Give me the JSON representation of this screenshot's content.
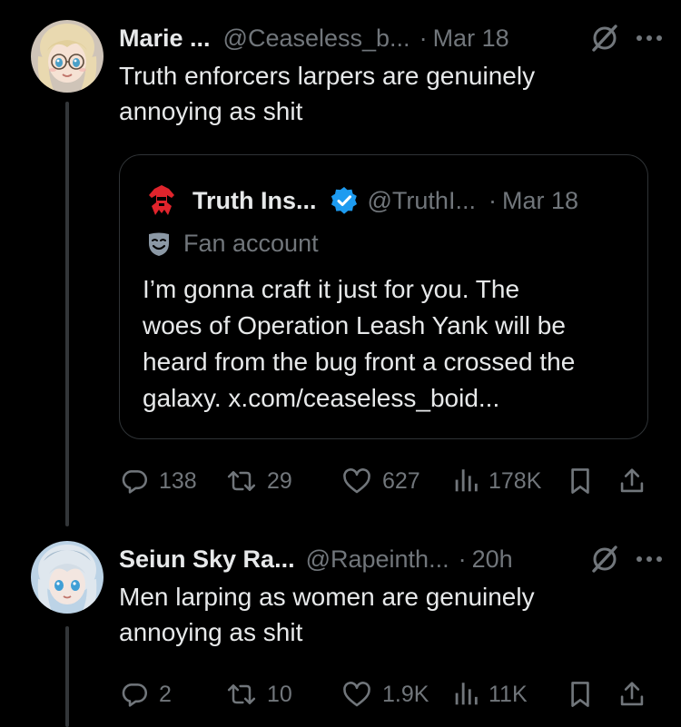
{
  "posts": [
    {
      "name": "Marie ...",
      "handle": "@Ceaseless_b...",
      "separator": "·",
      "time": "Mar 18",
      "lines": [
        "Truth enforcers larpers are genuinely",
        "annoying as shit"
      ],
      "stats": {
        "replies": "138",
        "reposts": "29",
        "likes": "627",
        "views": "178K"
      },
      "avatar_colors": {
        "hair": "#e9d9b0",
        "skin": "#f6e2d4",
        "eyes": "#4aa0c8",
        "bg": "#cfc4b8"
      }
    },
    {
      "name": "Seiun Sky Ra...",
      "handle": "@Rapeinth...",
      "separator": "·",
      "time": "20h",
      "lines": [
        "Men larping as women are genuinely",
        "annoying as shit"
      ],
      "stats": {
        "replies": "2",
        "reposts": "10",
        "likes": "1.9K",
        "views": "11K"
      },
      "avatar_colors": {
        "hair": "#dfe7ee",
        "skin": "#f3e6e0",
        "eyes": "#3f9fd6",
        "bg": "#bcd3e6"
      }
    }
  ],
  "quote": {
    "name": "Truth Ins...",
    "handle": "@TruthI...",
    "separator": "·",
    "time": "Mar 18",
    "label": "Fan account",
    "lines": [
      "I’m gonna craft it just for you. The",
      "woes of Operation Leash Yank will be",
      "heard from the bug front a crossed the",
      "galaxy. x.com/ceaseless_boid..."
    ]
  },
  "icons": {
    "grok": "grok-icon",
    "more": "more-icon",
    "verified": "verified-badge-icon",
    "mask": "fan-account-mask-icon",
    "reply": "reply-icon",
    "repost": "repost-icon",
    "like": "like-icon",
    "views": "views-icon",
    "bookmark": "bookmark-icon",
    "share": "share-icon"
  },
  "colors": {
    "background": "#000000",
    "text": "#e7e9ea",
    "secondary": "#71767b",
    "border": "#2f3336",
    "verified": "#1d9bf0",
    "logo": "#e0242c"
  }
}
